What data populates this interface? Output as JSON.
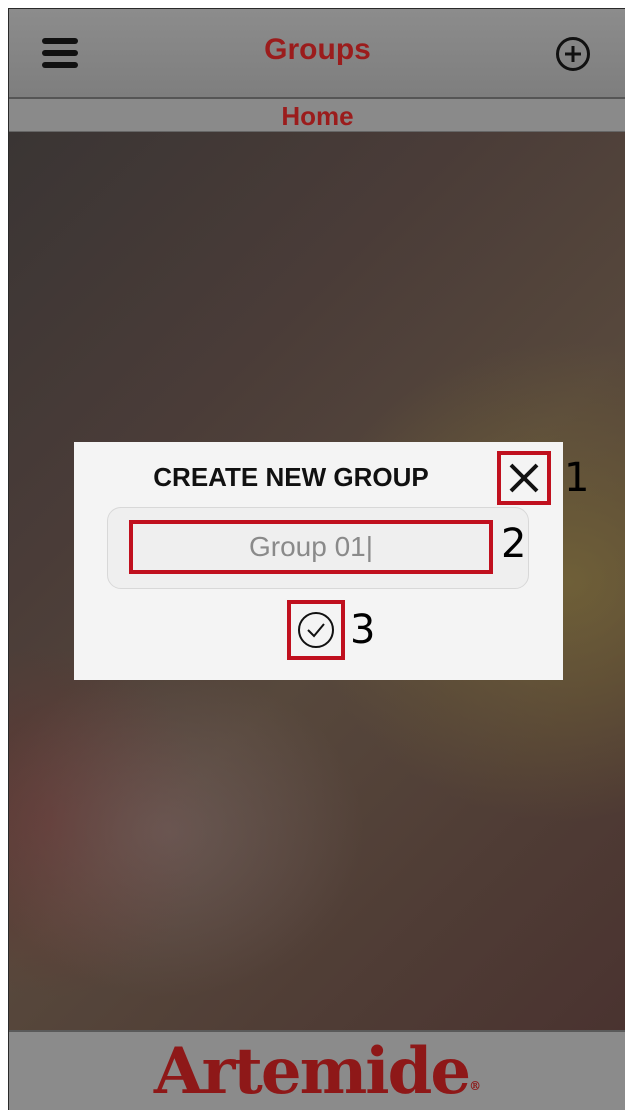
{
  "header": {
    "menu_icon": "hamburger-menu-icon",
    "title": "Groups",
    "add_icon": "add-circle-icon"
  },
  "subheader": {
    "title": "Home"
  },
  "dialog": {
    "title": "CREATE NEW GROUP",
    "close_icon": "close-x-icon",
    "input_value": "Group 01|",
    "confirm_icon": "check-circle-icon"
  },
  "callouts": [
    "1",
    "2",
    "3"
  ],
  "footer": {
    "brand": "Artemide",
    "registered_mark": "®"
  },
  "colors": {
    "brand_red": "#9b1c1c",
    "header_gray": "#868686",
    "highlight_red": "#c0101e",
    "dialog_bg": "#f4f4f4"
  }
}
